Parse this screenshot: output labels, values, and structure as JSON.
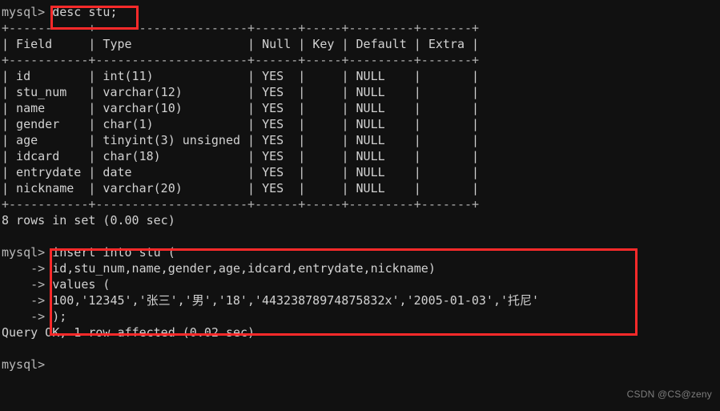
{
  "terminal": {
    "prompt": "mysql>",
    "continuation": "    ->",
    "background_color": "#111111",
    "text_color": "#cfcfcf",
    "highlight_color": "#fc2a2a",
    "lines": [
      {
        "kind": "command",
        "prompt": "mysql>",
        "text": "desc stu;",
        "highlighted": true
      },
      {
        "kind": "rule",
        "text": "+-----------+---------------------+------+-----+---------+-------+"
      },
      {
        "kind": "header",
        "text": "| Field     | Type                | Null | Key | Default | Extra |"
      },
      {
        "kind": "rule",
        "text": "+-----------+---------------------+------+-----+---------+-------+"
      },
      {
        "kind": "row",
        "text": "| id        | int(11)             | YES  |     | NULL    |       |"
      },
      {
        "kind": "row",
        "text": "| stu_num   | varchar(12)         | YES  |     | NULL    |       |"
      },
      {
        "kind": "row",
        "text": "| name      | varchar(10)         | YES  |     | NULL    |       |"
      },
      {
        "kind": "row",
        "text": "| gender    | char(1)             | YES  |     | NULL    |       |"
      },
      {
        "kind": "row",
        "text": "| age       | tinyint(3) unsigned | YES  |     | NULL    |       |"
      },
      {
        "kind": "row",
        "text": "| idcard    | char(18)            | YES  |     | NULL    |       |"
      },
      {
        "kind": "row",
        "text": "| entrydate | date                | YES  |     | NULL    |       |"
      },
      {
        "kind": "row",
        "text": "| nickname  | varchar(20)         | YES  |     | NULL    |       |"
      },
      {
        "kind": "rule",
        "text": "+-----------+---------------------+------+-----+---------+-------+"
      },
      {
        "kind": "status",
        "text": "8 rows in set (0.00 sec)"
      },
      {
        "kind": "blank",
        "text": ""
      },
      {
        "kind": "command",
        "prompt": "mysql>",
        "text": "insert into stu (",
        "highlighted": true
      },
      {
        "kind": "cont",
        "prompt": "    ->",
        "text": "id,stu_num,name,gender,age,idcard,entrydate,nickname)",
        "highlighted": true
      },
      {
        "kind": "cont",
        "prompt": "    ->",
        "text": "values (",
        "highlighted": true
      },
      {
        "kind": "cont",
        "prompt": "    ->",
        "text": "100,'12345','张三','男','18','44323878974875832x','2005-01-03','托尼'",
        "highlighted": true
      },
      {
        "kind": "cont",
        "prompt": "    ->",
        "text": ");",
        "highlighted": true
      },
      {
        "kind": "status",
        "text": "Query OK, 1 row affected (0.02 sec)"
      },
      {
        "kind": "blank",
        "text": ""
      },
      {
        "kind": "command",
        "prompt": "mysql>",
        "text": "",
        "highlighted": false
      }
    ]
  },
  "describe_result": {
    "table_name": "stu",
    "columns": [
      "Field",
      "Type",
      "Null",
      "Key",
      "Default",
      "Extra"
    ],
    "rows": [
      [
        "id",
        "int(11)",
        "YES",
        "",
        "NULL",
        ""
      ],
      [
        "stu_num",
        "varchar(12)",
        "YES",
        "",
        "NULL",
        ""
      ],
      [
        "name",
        "varchar(10)",
        "YES",
        "",
        "NULL",
        ""
      ],
      [
        "gender",
        "char(1)",
        "YES",
        "",
        "NULL",
        ""
      ],
      [
        "age",
        "tinyint(3) unsigned",
        "YES",
        "",
        "NULL",
        ""
      ],
      [
        "idcard",
        "char(18)",
        "YES",
        "",
        "NULL",
        ""
      ],
      [
        "entrydate",
        "date",
        "YES",
        "",
        "NULL",
        ""
      ],
      [
        "nickname",
        "varchar(20)",
        "YES",
        "",
        "NULL",
        ""
      ]
    ],
    "row_count_label": "8 rows in set (0.00 sec)"
  },
  "insert_statement": {
    "target_columns": [
      "id",
      "stu_num",
      "name",
      "gender",
      "age",
      "idcard",
      "entrydate",
      "nickname"
    ],
    "values": [
      "100",
      "12345",
      "张三",
      "男",
      "18",
      "44323878974875832x",
      "2005-01-03",
      "托尼"
    ],
    "result_label": "Query OK, 1 row affected (0.02 sec)"
  },
  "watermark": {
    "text": "CSDN @CS@zeny"
  }
}
